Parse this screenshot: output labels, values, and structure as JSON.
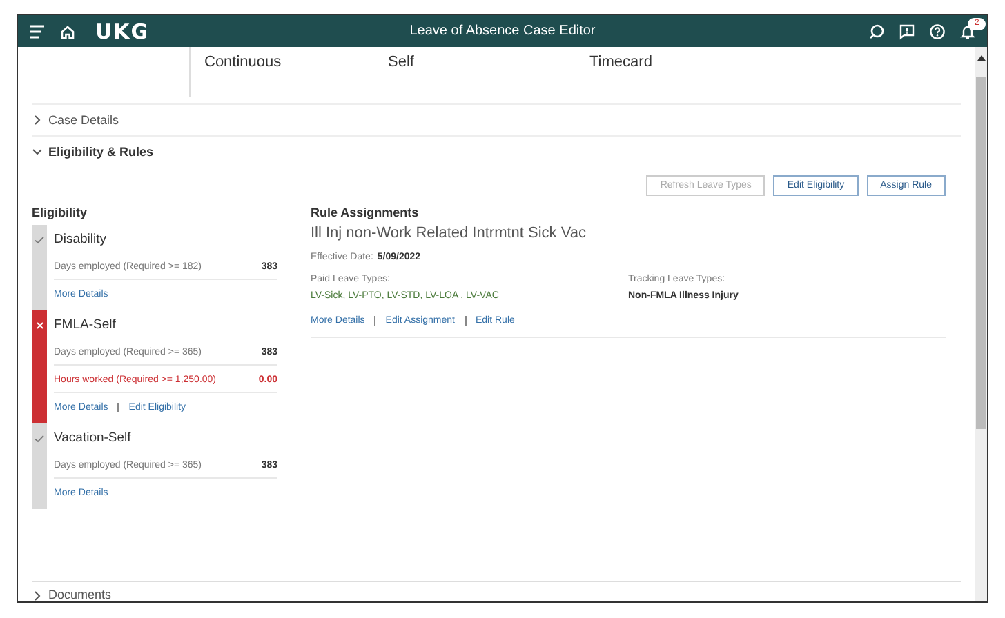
{
  "header": {
    "logo": "UKG",
    "title": "Leave of Absence Case Editor",
    "notification_count": "2"
  },
  "summary": [
    "Continuous",
    "Self",
    "Timecard"
  ],
  "sections": [
    {
      "label": "Case Details",
      "expanded": false
    },
    {
      "label": "Eligibility & Rules",
      "expanded": true
    }
  ],
  "actions": [
    {
      "label": "Refresh Leave Types",
      "disabled": true
    },
    {
      "label": "Edit Eligibility",
      "disabled": false
    },
    {
      "label": "Assign Rule",
      "disabled": false
    }
  ],
  "eligibility": {
    "title": "Eligibility",
    "items": [
      {
        "name": "Disability",
        "eligible": true,
        "criteria": [
          {
            "label": "Days employed (Required >= 182)",
            "value": "383",
            "failed": false
          }
        ],
        "links": [
          "More Details"
        ]
      },
      {
        "name": "FMLA-Self",
        "eligible": false,
        "criteria": [
          {
            "label": "Days employed (Required >= 365)",
            "value": "383",
            "failed": false
          },
          {
            "label": "Hours worked (Required >= 1,250.00)",
            "value": "0.00",
            "failed": true
          }
        ],
        "links": [
          "More Details",
          "Edit Eligibility"
        ]
      },
      {
        "name": "Vacation-Self",
        "eligible": true,
        "criteria": [
          {
            "label": "Days employed (Required >= 365)",
            "value": "383",
            "failed": false
          }
        ],
        "links": [
          "More Details"
        ]
      }
    ]
  },
  "rule_assignments": {
    "title": "Rule Assignments",
    "rule_name": "Ill Inj non-Work Related Intrmtnt Sick Vac",
    "effective_label": "Effective Date:",
    "effective_date": "5/09/2022",
    "paid_label": "Paid Leave Types:",
    "paid_value": "LV-Sick, LV-PTO, LV-STD, LV-LOA , LV-VAC",
    "tracking_label": "Tracking Leave Types:",
    "tracking_value": "Non-FMLA Illness Injury",
    "links": [
      "More Details",
      "Edit Assignment",
      "Edit Rule"
    ]
  },
  "bottom_section": {
    "label": "Documents",
    "expanded": false
  }
}
